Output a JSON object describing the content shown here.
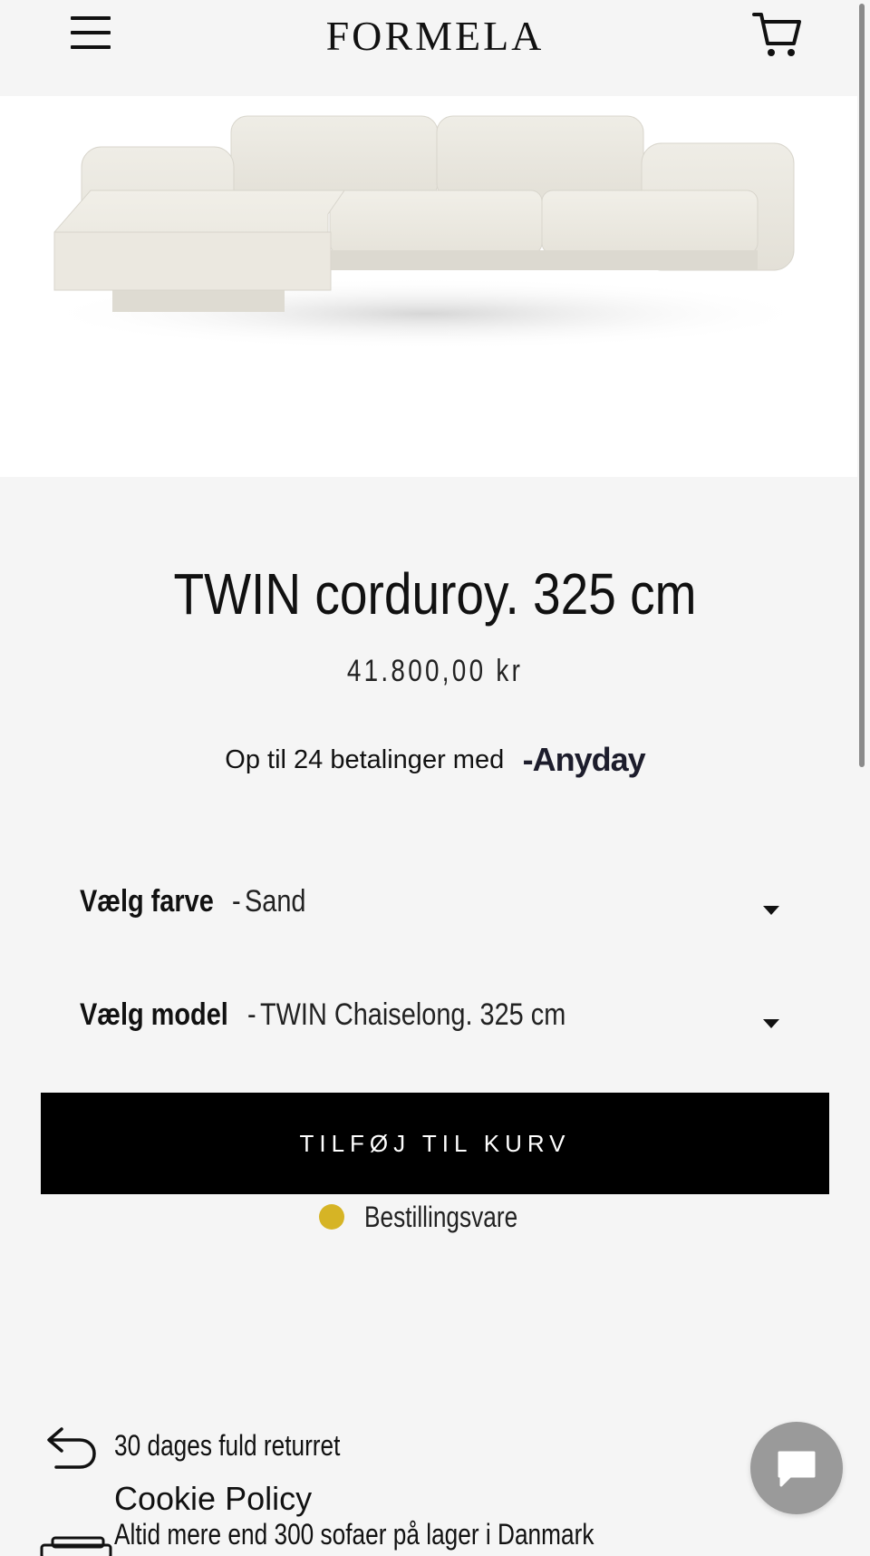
{
  "header": {
    "logo_text": "FORMELA"
  },
  "product": {
    "title": "TWIN corduroy. 325 cm",
    "price": "41.800,00 kr",
    "financing_text": "Op til 24 betalinger med",
    "financing_brand": "-Anyday"
  },
  "options": {
    "color_label": "Vælg farve",
    "color_separator": "-",
    "color_value": "Sand",
    "model_label": "Vælg model",
    "model_separator": "-",
    "model_value": "TWIN Chaiselong. 325 cm"
  },
  "cta": {
    "add_to_cart": "TILFØJ TIL KURV"
  },
  "availability": {
    "status": "Bestillingsvare",
    "color": "#d6b425"
  },
  "features": {
    "returns": "30 dages fuld returret",
    "stock": "Altid mere end 300 sofaer på lager i Danmark"
  },
  "footer": {
    "cookie_policy": "Cookie Policy"
  },
  "colors": {
    "background": "#f5f5f5",
    "button": "#000000",
    "chat_button": "#9a9a9a"
  }
}
